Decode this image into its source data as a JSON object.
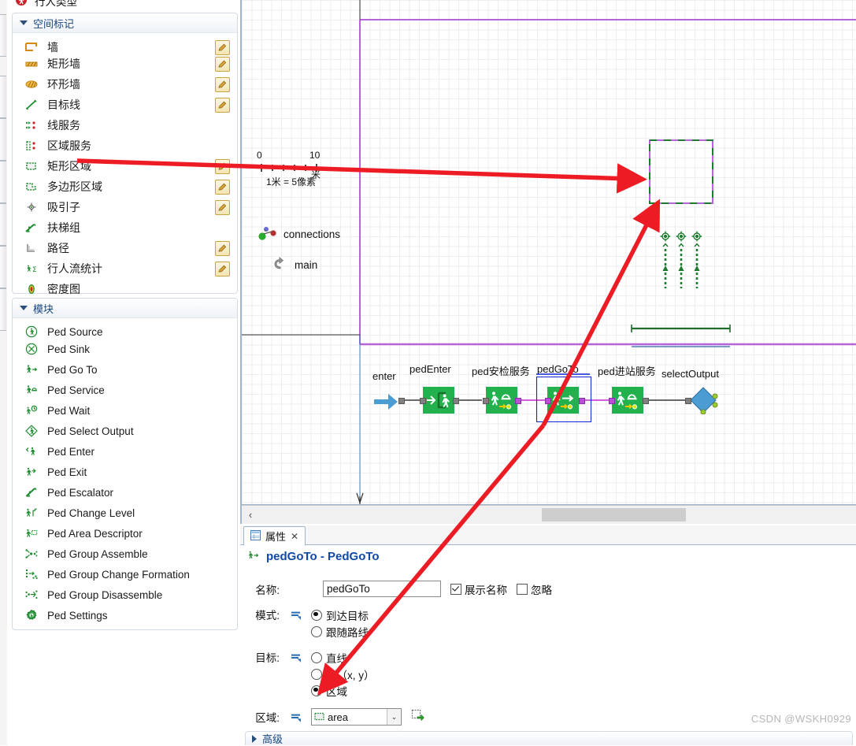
{
  "palette": {
    "cut_top_label": "行人类型",
    "groups": [
      {
        "name": "space-markup",
        "title": "空间标记",
        "items": [
          {
            "label": "墙",
            "icon": "wall-icon",
            "edit": true
          },
          {
            "label": "矩形墙",
            "icon": "rectangular-wall-icon",
            "edit": true
          },
          {
            "label": "环形墙",
            "icon": "circular-wall-icon",
            "edit": true
          },
          {
            "label": "目标线",
            "icon": "target-line-icon",
            "edit": true
          },
          {
            "label": "线服务",
            "icon": "line-service-icon",
            "edit": false
          },
          {
            "label": "区域服务",
            "icon": "area-service-icon",
            "edit": false
          },
          {
            "label": "矩形区域",
            "icon": "rectangular-area-icon",
            "edit": true
          },
          {
            "label": "多边形区域",
            "icon": "polygonal-area-icon",
            "edit": true
          },
          {
            "label": "吸引子",
            "icon": "attractor-icon",
            "edit": true
          },
          {
            "label": "扶梯组",
            "icon": "escalator-group-icon",
            "edit": false
          },
          {
            "label": "路径",
            "icon": "pathway-icon",
            "edit": true
          },
          {
            "label": "行人流统计",
            "icon": "ped-flow-statistics-icon",
            "edit": true
          },
          {
            "label": "密度图",
            "icon": "density-map-icon",
            "edit": false
          }
        ]
      },
      {
        "name": "modules",
        "title": "模块",
        "items": [
          {
            "label": "Ped Source",
            "icon": "ped-source-icon",
            "edit": false
          },
          {
            "label": "Ped Sink",
            "icon": "ped-sink-icon",
            "edit": false
          },
          {
            "label": "Ped Go To",
            "icon": "ped-go-to-icon",
            "edit": false
          },
          {
            "label": "Ped Service",
            "icon": "ped-service-icon",
            "edit": false
          },
          {
            "label": "Ped Wait",
            "icon": "ped-wait-icon",
            "edit": false
          },
          {
            "label": "Ped Select Output",
            "icon": "ped-select-output-icon",
            "edit": false
          },
          {
            "label": "Ped Enter",
            "icon": "ped-enter-icon",
            "edit": false
          },
          {
            "label": "Ped Exit",
            "icon": "ped-exit-icon",
            "edit": false
          },
          {
            "label": "Ped Escalator",
            "icon": "ped-escalator-icon",
            "edit": false
          },
          {
            "label": "Ped Change Level",
            "icon": "ped-change-level-icon",
            "edit": false
          },
          {
            "label": "Ped Area Descriptor",
            "icon": "ped-area-descriptor-icon",
            "edit": false
          },
          {
            "label": "Ped Group Assemble",
            "icon": "ped-group-assemble-icon",
            "edit": false
          },
          {
            "label": "Ped Group Change Formation",
            "icon": "ped-group-change-formation-icon",
            "edit": false
          },
          {
            "label": "Ped Group Disassemble",
            "icon": "ped-group-disassemble-icon",
            "edit": false
          },
          {
            "label": "Ped Settings",
            "icon": "ped-settings-icon",
            "edit": false
          }
        ]
      }
    ]
  },
  "canvas": {
    "ruler": {
      "tick_start": "0",
      "tick_end": "10",
      "unit": "米",
      "scale_text": "1米 = 5像素"
    },
    "embedded_objects": [
      {
        "label": "connections",
        "icon": "connections-icon"
      },
      {
        "label": "main",
        "icon": "main-agent-icon"
      }
    ],
    "flow_nodes": [
      {
        "label": "enter",
        "type": "entry-arrow"
      },
      {
        "label": "pedEnter",
        "type": "ped-enter"
      },
      {
        "label": "ped安检服务",
        "type": "ped-service"
      },
      {
        "label": "pedGoTo",
        "type": "ped-go-to",
        "selected": true
      },
      {
        "label": "ped进站服务",
        "type": "ped-service"
      },
      {
        "label": "selectOutput",
        "type": "select-output"
      }
    ],
    "scrollbar": {
      "left_arrow": "‹"
    }
  },
  "properties": {
    "tab_label": "属性",
    "tab_close": "✕",
    "title": "pedGoTo - PedGoTo",
    "name_row": {
      "label": "名称:",
      "value": "pedGoTo",
      "show_name": {
        "label": "展示名称",
        "checked": true
      },
      "ignore": {
        "label": "忽略",
        "checked": false
      }
    },
    "mode_row": {
      "label": "模式:",
      "options": [
        {
          "label": "到达目标",
          "selected": true
        },
        {
          "label": "跟随路线",
          "selected": false
        }
      ]
    },
    "target_row": {
      "label": "目标:",
      "options": [
        {
          "label": "直线",
          "selected": false
        },
        {
          "label": "点（x, y）",
          "selected": false
        },
        {
          "label": "区域",
          "selected": true
        }
      ]
    },
    "area_row": {
      "label": "区域:",
      "value": "area",
      "dropdown_arrow": "⌄"
    },
    "advanced_section": "高级"
  },
  "watermark": "CSDN @WSKH0929",
  "colors": {
    "node_green": "#22b14c",
    "selection_blue": "#0a28d8",
    "connector_magenta": "#c02ad0",
    "annotation_red": "#ed1c24",
    "area_purple": "#b565d8",
    "title_blue": "#1149a8",
    "group_title": "#18457f"
  }
}
